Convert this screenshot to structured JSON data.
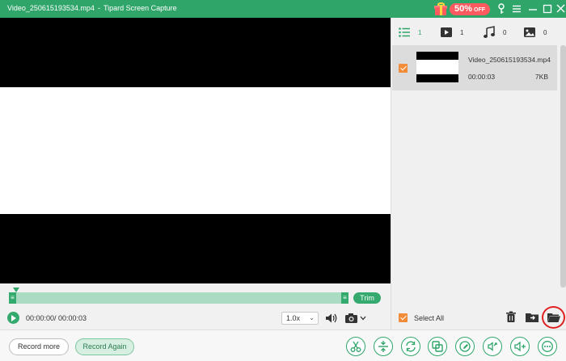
{
  "window": {
    "file_title": "Video_250615193534.mp4",
    "separator": "-",
    "app_name": "Tipard Screen Capture"
  },
  "promo": {
    "percent": "50%",
    "off": "OFF"
  },
  "player": {
    "trim_label": "Trim",
    "timecode": "00:00:00/ 00:00:03",
    "speed_value": "1.0x"
  },
  "media_tabs": [
    {
      "type": "list",
      "count": "1"
    },
    {
      "type": "video",
      "count": "1"
    },
    {
      "type": "audio",
      "count": "0"
    },
    {
      "type": "image",
      "count": "0"
    }
  ],
  "files": [
    {
      "name": "Video_250615193534.mp4",
      "duration": "00:00:03",
      "size": "7KB",
      "checked": true
    }
  ],
  "select_all_label": "Select All",
  "buttons": {
    "record_more": "Record more",
    "record_again": "Record Again"
  },
  "tools": [
    "scissors-icon",
    "split-icon",
    "rotate-icon",
    "merge-icon",
    "edit-icon",
    "compress-icon",
    "volume-adjust-icon",
    "more-icon"
  ],
  "colors": {
    "brand": "#2fa56a",
    "promo": "#ff5a5f",
    "checkbox": "#f28c38",
    "highlight": "#e02020"
  }
}
